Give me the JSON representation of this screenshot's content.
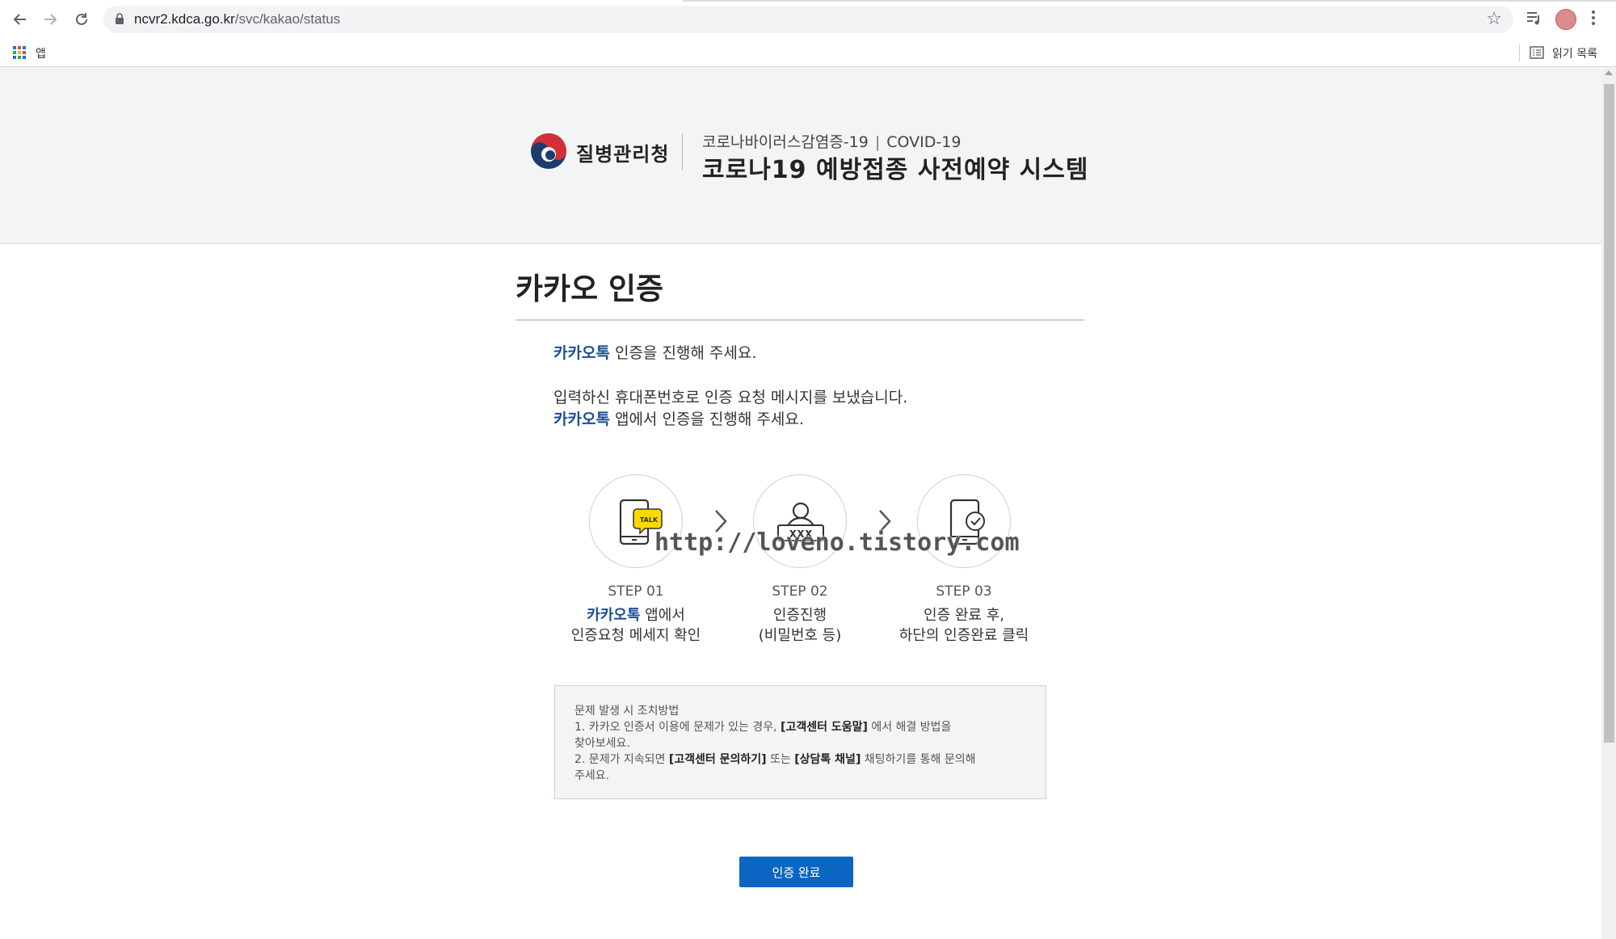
{
  "browser": {
    "url_host": "ncvr2.kdca.go.kr",
    "url_path": "/svc/kakao/status",
    "bookmarks": {
      "apps_label": "앱",
      "reading_list_label": "읽기 목록"
    }
  },
  "header": {
    "agency_name": "질병관리청",
    "subtitle_kr": "코로나바이러스감염증-19",
    "subtitle_sep": "|",
    "subtitle_en": "COVID-19",
    "system_title": "코로나19 예방접종 사전예약 시스템"
  },
  "main": {
    "title": "카카오 인증",
    "kakao_word": "카카오톡",
    "intro_line1_rest": " 인증을 진행해 주세요.",
    "intro_line2": "입력하신 휴대폰번호로 인증 요청 메시지를 보냈습니다.",
    "intro_line3_rest": " 앱에서 인증을 진행해 주세요."
  },
  "steps": [
    {
      "label": "STEP 01",
      "desc_highlight": "카카오톡",
      "desc_line1_rest": " 앱에서",
      "desc_line2": "인증요청 메세지 확인",
      "icon_text": "TALK"
    },
    {
      "label": "STEP 02",
      "desc_line1": "인증진행",
      "desc_line2": "(비밀번호 등)",
      "icon_text": "xxx"
    },
    {
      "label": "STEP 03",
      "desc_line1": "인증 완료 후,",
      "desc_line2": "하단의 인증완료 클릭"
    }
  ],
  "watermark": "http://loveno.tistory.com",
  "notice": {
    "heading": "문제 발생 시 조치방법",
    "l1_a": "1. 카카오 인증서 이용에 문제가 있는 경우, ",
    "l1_b": "[고객센터 도움말]",
    "l1_c": " 에서 해결 방법을",
    "l1_d": "찾아보세요.",
    "l2_a": "2. 문제가 지속되면 ",
    "l2_b": "[고객센터 문의하기]",
    "l2_c": " 또는 ",
    "l2_d": "[상담톡 채널]",
    "l2_e": " 채팅하기를 통해 문의해",
    "l2_f": "주세요."
  },
  "button": {
    "label": "인증 완료"
  },
  "colors": {
    "kakao_text": "#1c4e96",
    "button_bg": "#0b66c3",
    "kakao_yellow": "#ffd800"
  }
}
